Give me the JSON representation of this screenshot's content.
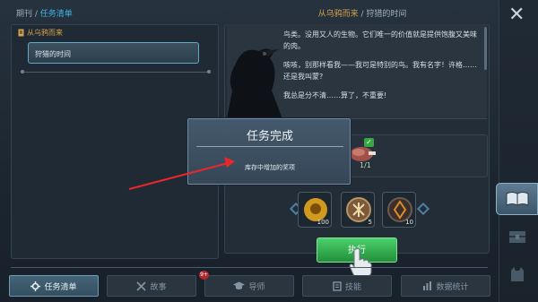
{
  "header": {
    "breadcrumb_parent": "期刊",
    "breadcrumb_sep": " / ",
    "breadcrumb_current": "任务清单",
    "quest_line": "从乌鸦而来",
    "quest_sep": " / ",
    "quest_name": "狩猎的时间"
  },
  "quest_list": {
    "group_label": "从乌鸦而来",
    "items": [
      {
        "label": "狩猎的时间",
        "selected": true
      }
    ]
  },
  "story": {
    "paragraphs": [
      "鸟类。没用又人的生物。它们唯一的价值就是提供饱腹又美味的肉。",
      "咳咳，别那样看我——我可是特别的鸟。我有名字！许格……还是我叫蒙?",
      "我总是分不清……算了，不重要!"
    ]
  },
  "objective": {
    "count": "1/1",
    "complete": true
  },
  "rewards": [
    {
      "icon": "skull-coin-icon",
      "count": "100",
      "color": "#d19a1f"
    },
    {
      "icon": "rune-token-icon",
      "count": "5",
      "color": "#7a5a3a"
    },
    {
      "icon": "rune-badge-icon",
      "count": "10",
      "color": "#3a2f2a"
    }
  ],
  "action": {
    "execute_label": "执行"
  },
  "modal": {
    "title": "任务完成",
    "message": "库存中增加的奖项"
  },
  "bottom_tabs": [
    {
      "label": "任务清单",
      "icon": "gear-icon",
      "active": true
    },
    {
      "label": "故事",
      "icon": "swords-icon",
      "active": false
    },
    {
      "label": "导师",
      "icon": "mortarboard-icon",
      "active": false
    },
    {
      "label": "技能",
      "icon": "scroll-icon",
      "active": false
    },
    {
      "label": "数据统计",
      "icon": "chart-icon",
      "active": false
    }
  ],
  "badge": {
    "count": "9+"
  },
  "colors": {
    "accent": "#3fb6e6",
    "gold": "#d4a34d",
    "success": "#37a744",
    "annotation": "#e8282a"
  }
}
